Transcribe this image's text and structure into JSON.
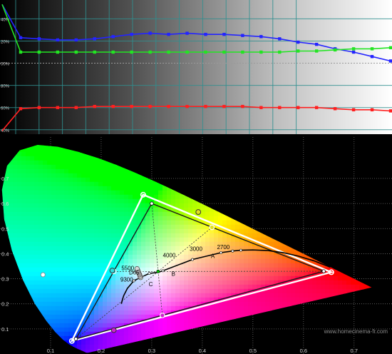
{
  "chart_data": [
    {
      "type": "line",
      "title": "",
      "xlabel": "",
      "ylabel": "",
      "background": "grayscale gradient black to white",
      "grid": true,
      "y_tick_labels": [
        "40%",
        "20%",
        "00%",
        "80%",
        "60%",
        "40%"
      ],
      "y_ticks": [
        140,
        120,
        100,
        80,
        60,
        40
      ],
      "ylim": [
        36,
        157
      ],
      "reference_value": 100,
      "x": [
        0,
        1,
        2,
        3,
        4,
        5,
        6,
        7,
        8,
        9,
        10,
        11,
        12,
        13,
        14,
        15,
        16,
        17,
        18,
        19,
        20,
        21
      ],
      "xlim": [
        0,
        21
      ],
      "series": [
        {
          "color": "#2424ff",
          "values": [
            153,
            123,
            122,
            121,
            121,
            122,
            124,
            126,
            127,
            126,
            127,
            126,
            126,
            125,
            124,
            122,
            119,
            117,
            113,
            110,
            106,
            102
          ]
        },
        {
          "color": "#22e522",
          "values": [
            153,
            110,
            110,
            110,
            110,
            110,
            110,
            110,
            110,
            110,
            110,
            110,
            110,
            110,
            110,
            110,
            111,
            111,
            112,
            113,
            113,
            114
          ]
        },
        {
          "color": "#ff2020",
          "values": [
            39,
            59,
            60,
            60,
            60,
            61,
            61,
            61,
            61,
            61,
            61,
            61,
            61,
            61,
            60,
            60,
            60,
            60,
            59,
            58,
            58,
            57
          ]
        }
      ]
    },
    {
      "type": "scatter",
      "title": "",
      "xlabel": "",
      "ylabel": "",
      "xlim": [
        0,
        0.775
      ],
      "ylim": [
        0,
        0.865
      ],
      "x_ticks": [
        0.1,
        0.2,
        0.3,
        0.4,
        0.5,
        0.6,
        0.7
      ],
      "x_tick_labels": [
        "0.1",
        "0.2",
        "0.3",
        "0.4",
        "0.5",
        "0.6",
        "0.7"
      ],
      "y_ticks": [
        0.1,
        0.2,
        0.3,
        0.4,
        0.5,
        0.6,
        0.7
      ],
      "y_tick_labels": [
        "0.1",
        "0.2",
        "0.3",
        "0.4",
        "0.5",
        "0.6",
        "0.7"
      ],
      "grid": true,
      "spectral_locus": [
        [
          0.1741,
          0.005
        ],
        [
          0.1738,
          0.0049
        ],
        [
          0.1736,
          0.0049
        ],
        [
          0.1733,
          0.0048
        ],
        [
          0.173,
          0.0048
        ],
        [
          0.1726,
          0.0048
        ],
        [
          0.1721,
          0.0048
        ],
        [
          0.1714,
          0.0051
        ],
        [
          0.1703,
          0.0058
        ],
        [
          0.1689,
          0.0069
        ],
        [
          0.1669,
          0.0086
        ],
        [
          0.1644,
          0.0109
        ],
        [
          0.1611,
          0.0138
        ],
        [
          0.1566,
          0.0177
        ],
        [
          0.151,
          0.0227
        ],
        [
          0.144,
          0.0297
        ],
        [
          0.1355,
          0.0399
        ],
        [
          0.1241,
          0.0578
        ],
        [
          0.1096,
          0.0868
        ],
        [
          0.0913,
          0.1327
        ],
        [
          0.0687,
          0.2007
        ],
        [
          0.0454,
          0.295
        ],
        [
          0.0235,
          0.4127
        ],
        [
          0.0082,
          0.5384
        ],
        [
          0.0039,
          0.6548
        ],
        [
          0.0139,
          0.7502
        ],
        [
          0.0389,
          0.812
        ],
        [
          0.0743,
          0.8338
        ],
        [
          0.1142,
          0.8262
        ],
        [
          0.1547,
          0.8059
        ],
        [
          0.1929,
          0.7816
        ],
        [
          0.2296,
          0.7543
        ],
        [
          0.2658,
          0.7243
        ],
        [
          0.3016,
          0.6923
        ],
        [
          0.3373,
          0.6589
        ],
        [
          0.3731,
          0.6245
        ],
        [
          0.4087,
          0.5896
        ],
        [
          0.4441,
          0.5547
        ],
        [
          0.4788,
          0.5202
        ],
        [
          0.5125,
          0.4866
        ],
        [
          0.5448,
          0.4544
        ],
        [
          0.5752,
          0.4242
        ],
        [
          0.6029,
          0.3965
        ],
        [
          0.627,
          0.3725
        ],
        [
          0.6482,
          0.3514
        ],
        [
          0.6658,
          0.334
        ],
        [
          0.6801,
          0.3197
        ],
        [
          0.6915,
          0.3083
        ],
        [
          0.7006,
          0.2993
        ],
        [
          0.7079,
          0.292
        ],
        [
          0.714,
          0.2859
        ],
        [
          0.719,
          0.2809
        ],
        [
          0.723,
          0.277
        ],
        [
          0.726,
          0.274
        ],
        [
          0.7283,
          0.2717
        ],
        [
          0.73,
          0.27
        ],
        [
          0.7311,
          0.2689
        ],
        [
          0.732,
          0.268
        ],
        [
          0.7327,
          0.2673
        ],
        [
          0.7334,
          0.2666
        ],
        [
          0.734,
          0.266
        ],
        [
          0.7344,
          0.2656
        ],
        [
          0.7346,
          0.2654
        ],
        [
          0.7347,
          0.2653
        ]
      ],
      "reference_gamut": [
        [
          0.64,
          0.33
        ],
        [
          0.3,
          0.6
        ],
        [
          0.15,
          0.06
        ]
      ],
      "measured_gamut": [
        [
          0.655,
          0.326
        ],
        [
          0.283,
          0.635
        ],
        [
          0.142,
          0.052
        ]
      ],
      "secondaries_target": [
        [
          0.225,
          0.329
        ],
        [
          0.321,
          0.154
        ],
        [
          0.419,
          0.505
        ]
      ],
      "secondaries_measured": [
        [
          0.222,
          0.333
        ],
        [
          0.225,
          0.095
        ],
        [
          0.392,
          0.566
        ]
      ],
      "edge_markers": [
        [
          0.085,
          0.316
        ]
      ],
      "white_point_target": [
        0.3127,
        0.329
      ],
      "white_points_measured": [
        [
          0.278,
          0.305
        ],
        [
          0.277,
          0.31
        ],
        [
          0.276,
          0.316
        ],
        [
          0.275,
          0.32
        ],
        [
          0.274,
          0.325
        ],
        [
          0.273,
          0.33
        ],
        [
          0.272,
          0.335
        ],
        [
          0.271,
          0.34
        ]
      ],
      "planckian_locus": [
        [
          0.24,
          0.2
        ],
        [
          0.2407,
          0.2059
        ],
        [
          0.2422,
          0.2181
        ],
        [
          0.2447,
          0.2337
        ],
        [
          0.2518,
          0.2615
        ],
        [
          0.2646,
          0.2918
        ],
        [
          0.2803,
          0.3075
        ],
        [
          0.2952,
          0.3213
        ],
        [
          0.3124,
          0.3256
        ],
        [
          0.3221,
          0.3318
        ],
        [
          0.3805,
          0.3768
        ],
        [
          0.4369,
          0.4041
        ],
        [
          0.4599,
          0.4106
        ],
        [
          0.4762,
          0.4137
        ],
        [
          0.5,
          0.4149
        ],
        [
          0.53,
          0.4123
        ],
        [
          0.5604,
          0.4038
        ],
        [
          0.59,
          0.39
        ],
        [
          0.62,
          0.372
        ],
        [
          0.653,
          0.346
        ]
      ],
      "cct_points": [
        [
          0.2646,
          0.2918
        ],
        [
          0.2803,
          0.3075
        ],
        [
          0.2952,
          0.3213
        ],
        [
          0.3221,
          0.3318
        ],
        [
          0.3805,
          0.3768
        ],
        [
          0.4369,
          0.4041
        ],
        [
          0.4599,
          0.4106
        ],
        [
          0.4762,
          0.4137
        ]
      ],
      "annotations": [
        {
          "text": "9300",
          "x": 0.238,
          "y": 0.289
        },
        {
          "text": "D65",
          "x": 0.255,
          "y": 0.317
        },
        {
          "text": "5500",
          "x": 0.24,
          "y": 0.335
        },
        {
          "text": "4000",
          "x": 0.322,
          "y": 0.385
        },
        {
          "text": "3000",
          "x": 0.375,
          "y": 0.411
        },
        {
          "text": "2700",
          "x": 0.429,
          "y": 0.418
        },
        {
          "text": "A",
          "x": 0.417,
          "y": 0.383
        },
        {
          "text": "B",
          "x": 0.339,
          "y": 0.312
        },
        {
          "text": "C",
          "x": 0.294,
          "y": 0.27
        }
      ],
      "watermark": "www.homecinema-fr.com"
    }
  ]
}
